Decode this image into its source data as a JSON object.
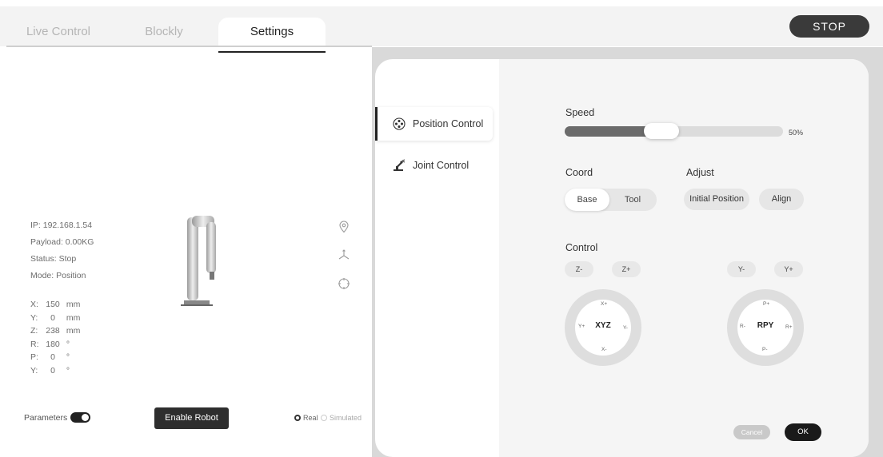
{
  "tabs": [
    {
      "label": "Live Control"
    },
    {
      "label": "Blockly"
    },
    {
      "label": "Settings"
    }
  ],
  "stop_label": "STOP",
  "info": {
    "ip": "IP: 192.168.1.54",
    "payload": "Payload: 0.00KG",
    "status": "Status: Stop",
    "mode": "Mode: Position"
  },
  "coords": [
    {
      "axis": "X:",
      "value": "150",
      "unit": "mm"
    },
    {
      "axis": "Y:",
      "value": "0",
      "unit": "mm"
    },
    {
      "axis": "Z:",
      "value": "238",
      "unit": "mm"
    },
    {
      "axis": "R:",
      "value": "180",
      "unit": "°"
    },
    {
      "axis": "P:",
      "value": "0",
      "unit": "°"
    },
    {
      "axis": "Y:",
      "value": "0",
      "unit": "°"
    }
  ],
  "parameters_label": "Parameters",
  "parameters_on": true,
  "enable_label": "Enable Robot",
  "mode_options": {
    "real": "Real",
    "simulated": "Simulated",
    "selected": "real"
  },
  "nav": {
    "position": "Position Control",
    "joint": "Joint Control"
  },
  "speed": {
    "label": "Speed",
    "percent": 50,
    "display": "50%"
  },
  "coord": {
    "label": "Coord",
    "base": "Base",
    "tool": "Tool",
    "selected": "Base"
  },
  "adjust": {
    "label": "Adjust",
    "initial": "Initial Position",
    "align": "Align"
  },
  "control": {
    "label": "Control",
    "z_minus": "Z-",
    "z_plus": "Z+",
    "y_minus": "Y-",
    "y_plus": "Y+",
    "xyz": {
      "center": "XYZ",
      "top": "X+",
      "bottom": "X-",
      "left": "Y+",
      "right": "Y-"
    },
    "rpy": {
      "center": "RPY",
      "top": "P+",
      "bottom": "P-",
      "left": "R-",
      "right": "R+"
    }
  },
  "cancel_label": "Cancel",
  "ok_label": "OK",
  "colors": {
    "accent": "#222222",
    "stop": "#3a3a3a",
    "slider_fill": "#6b6b6b"
  }
}
